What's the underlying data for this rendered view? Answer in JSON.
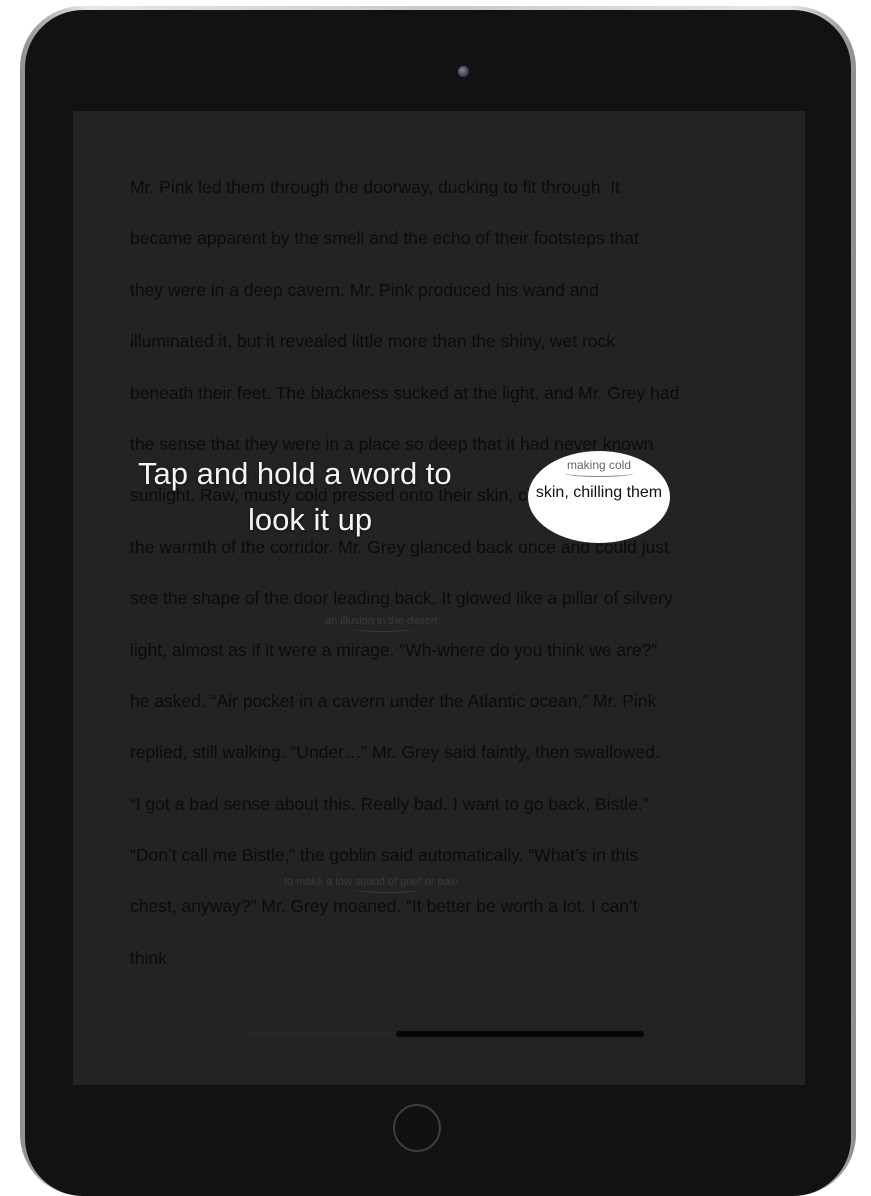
{
  "reader": {
    "lines": [
      "Mr. Pink led them through the doorway, ducking to fit through. It",
      "became apparent by the smell and the echo of their footsteps that",
      "they were in a deep cavern. Mr. Pink produced his wand and",
      "illuminated it, but it revealed little more than the shiny, wet rock",
      "beneath their feet. The blackness sucked at the light, and Mr. Grey had",
      "the sense that they were in a place so deep that it had never known",
      "sunlight. Raw, musty cold pressed onto their skin, chilling them after",
      "the warmth of the corridor. Mr. Grey glanced back once and could just",
      "see the shape of the door leading back. It glowed like a pillar of silvery",
      "light, almost as if it were a mirage. “Wh-where do you think we are?”",
      "he asked. “Air pocket in a cavern under the Atlantic ocean,” Mr. Pink",
      "replied, still walking. “Under…” Mr. Grey said faintly, then swallowed.",
      "“I got a bad sense about this. Really bad. I want to go back, Bistle.”",
      "“Don’t call me Bistle,” the goblin said automatically. “What’s in this",
      "chest, anyway?” Mr. Grey moaned. “It better be worth a lot. I can’t",
      "think"
    ],
    "glosses": {
      "mirage": "an illusion in the desert",
      "moaned": "to make a low sound of grief or pain"
    },
    "progress": 0.62
  },
  "overlay": {
    "hint_line1": "Tap and hold a word to",
    "hint_line2": "look it up",
    "bubble_gloss": "making cold",
    "bubble_text": "skin, chilling them"
  }
}
